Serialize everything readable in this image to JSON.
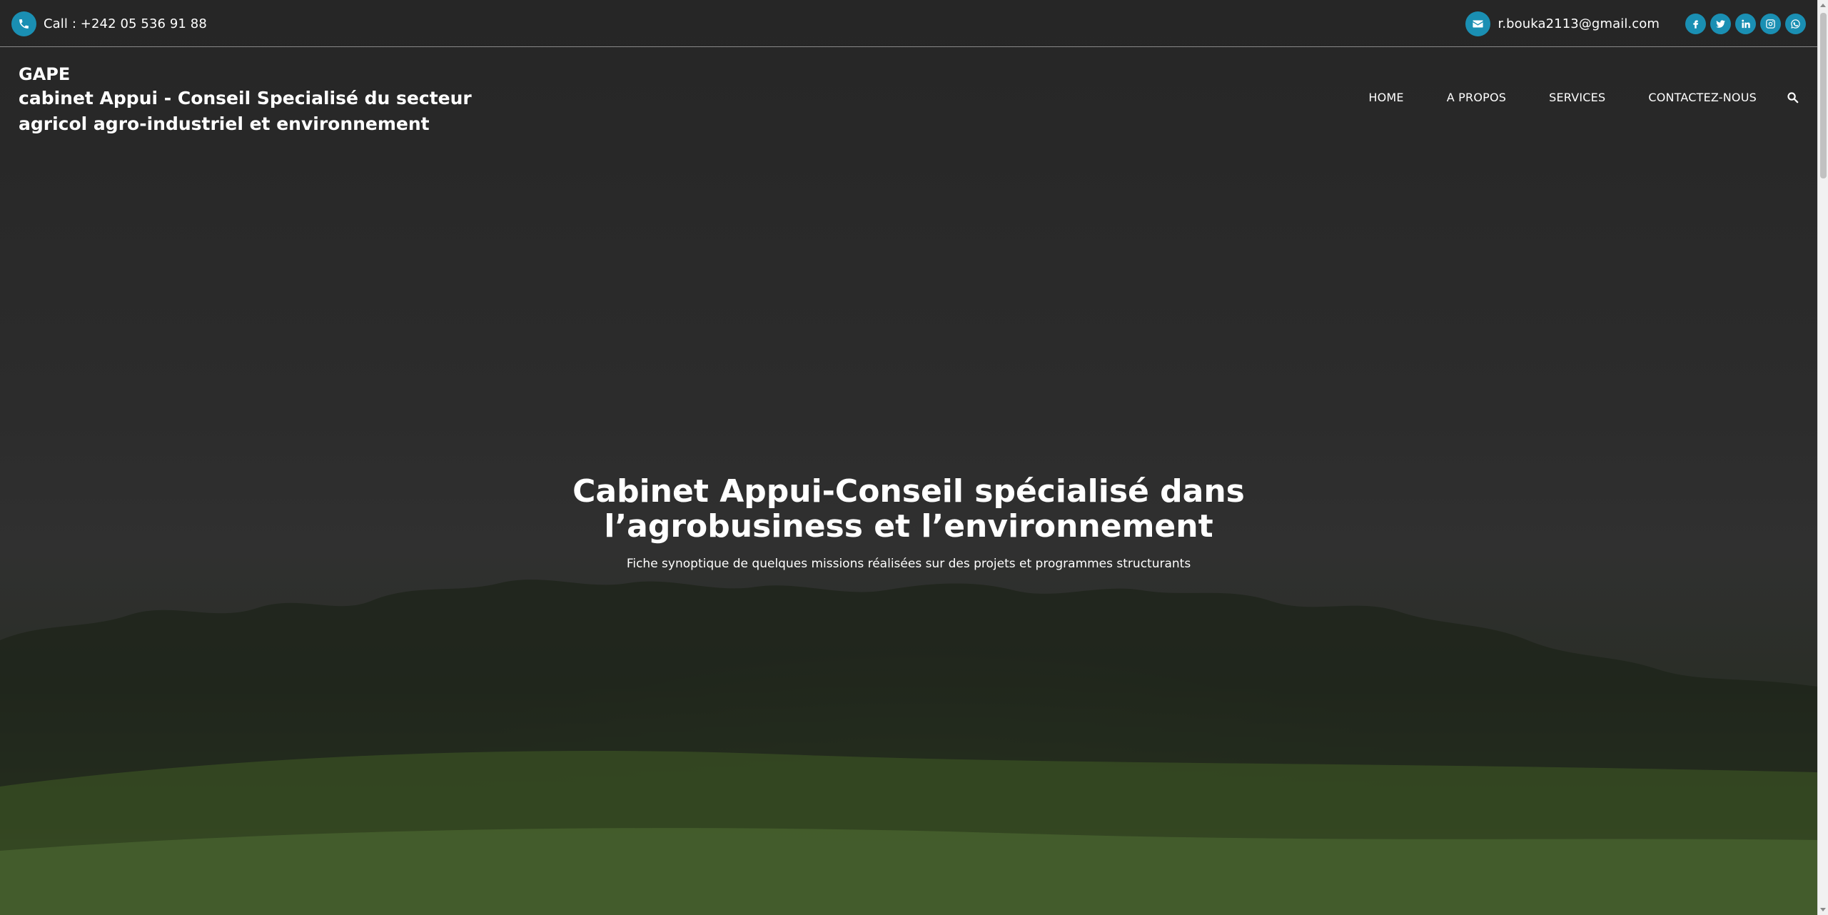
{
  "topbar": {
    "phone_text": "Call : +242 05 536 91 88",
    "email_text": "r.bouka2113@gmail.com",
    "accent_color": "#1a8fb3",
    "social_icons": [
      "facebook-icon",
      "twitter-icon",
      "linkedin-icon",
      "instagram-icon",
      "whatsapp-icon"
    ]
  },
  "brand": {
    "name": "GAPE",
    "tagline": "cabinet Appui - Conseil Specialisé du secteur agricol agro-industriel et environnement"
  },
  "nav": {
    "items": [
      "HOME",
      "A PROPOS",
      "SERVICES",
      "CONTACTEZ-NOUS"
    ],
    "search_icon": "search-icon"
  },
  "hero": {
    "title_line1": "Cabinet Appui-Conseil spécialisé dans",
    "title_line2": "l’agrobusiness et l’environnement",
    "subtitle": "Fiche synoptique de quelques missions réalisées sur des projets et programmes structurants"
  }
}
